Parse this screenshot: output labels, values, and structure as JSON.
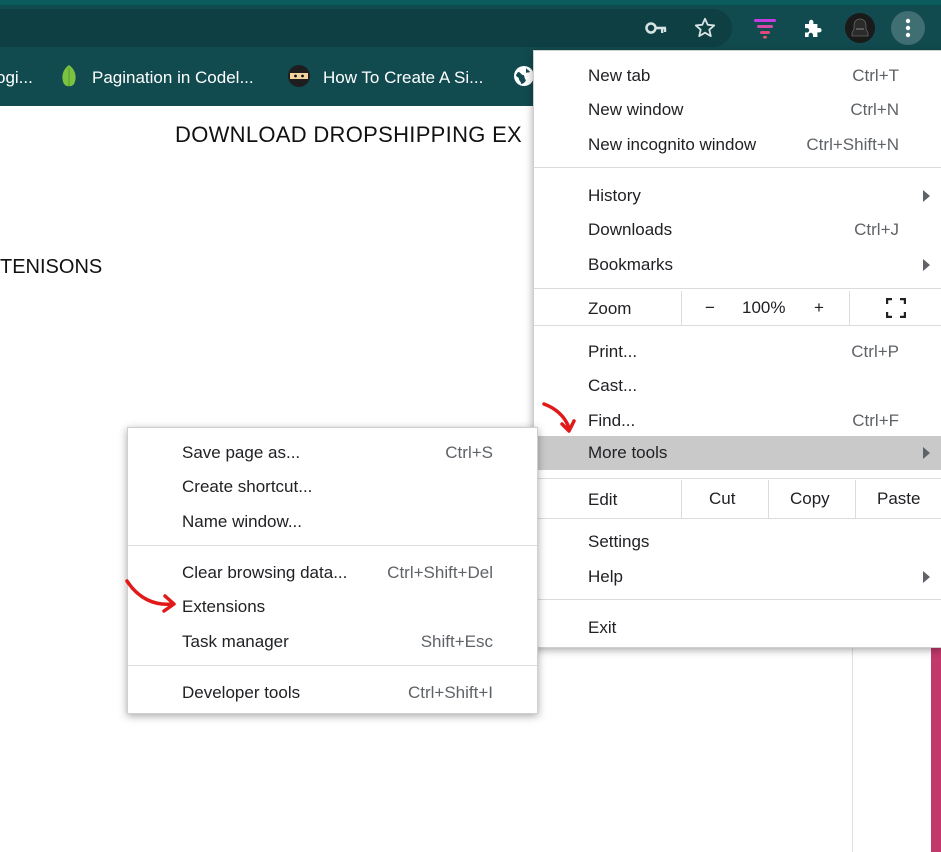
{
  "page": {
    "title": "DOWNLOAD DROPSHIPPING EX",
    "subtitle": "TENISONS"
  },
  "toolbar": {
    "icons": [
      "key-icon",
      "star-icon",
      "extension-stack-icon",
      "puzzle-icon",
      "profile-avatar",
      "more-vert-icon"
    ]
  },
  "bookmarks": [
    {
      "label": "ogi...",
      "icon": "partial-icon"
    },
    {
      "label": "Pagination in Codel...",
      "icon": "leaf-icon"
    },
    {
      "label": "How To Create A Si...",
      "icon": "ninja-icon"
    },
    {
      "label": "",
      "icon": "globe-icon"
    }
  ],
  "menu": {
    "new_tab": {
      "label": "New tab",
      "shortcut": "Ctrl+T"
    },
    "new_window": {
      "label": "New window",
      "shortcut": "Ctrl+N"
    },
    "new_incognito": {
      "label": "New incognito window",
      "shortcut": "Ctrl+Shift+N"
    },
    "history": {
      "label": "History"
    },
    "downloads": {
      "label": "Downloads",
      "shortcut": "Ctrl+J"
    },
    "bookmarks": {
      "label": "Bookmarks"
    },
    "zoom": {
      "label": "Zoom",
      "minus": "−",
      "value": "100%",
      "plus": "+"
    },
    "print": {
      "label": "Print...",
      "shortcut": "Ctrl+P"
    },
    "cast": {
      "label": "Cast..."
    },
    "find": {
      "label": "Find...",
      "shortcut": "Ctrl+F"
    },
    "more_tools": {
      "label": "More tools"
    },
    "edit": {
      "label": "Edit",
      "cut": "Cut",
      "copy": "Copy",
      "paste": "Paste"
    },
    "settings": {
      "label": "Settings"
    },
    "help": {
      "label": "Help"
    },
    "exit": {
      "label": "Exit"
    }
  },
  "submenu": {
    "save_page": {
      "label": "Save page as...",
      "shortcut": "Ctrl+S"
    },
    "create_shortcut": {
      "label": "Create shortcut..."
    },
    "name_window": {
      "label": "Name window..."
    },
    "clear_browsing": {
      "label": "Clear browsing data...",
      "shortcut": "Ctrl+Shift+Del"
    },
    "extensions": {
      "label": "Extensions"
    },
    "task_manager": {
      "label": "Task manager",
      "shortcut": "Shift+Esc"
    },
    "developer_tools": {
      "label": "Developer tools",
      "shortcut": "Ctrl+Shift+I"
    }
  },
  "colors": {
    "toolbar_bg": "#114b4f",
    "highlight": "#c9c9c9",
    "annotation_arrow": "#e11919",
    "accent_pink": "#c2386b"
  }
}
